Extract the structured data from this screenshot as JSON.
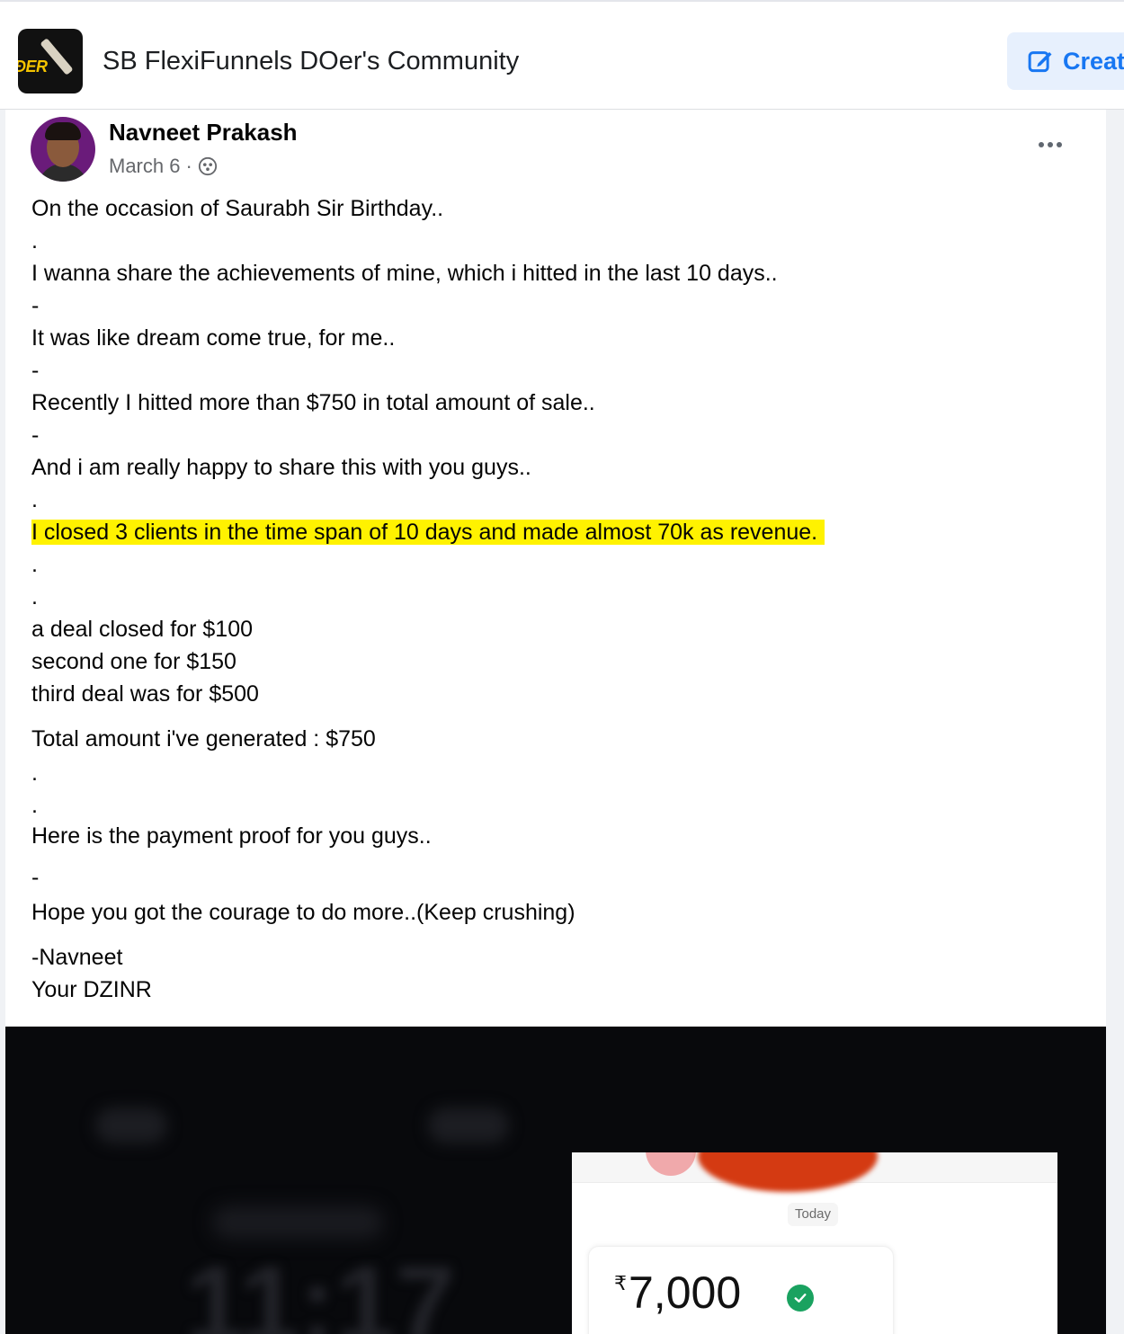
{
  "header": {
    "group_logo_text": "ÐER",
    "group_name": "SB FlexiFunnels DOer's Community",
    "create_label": "Creat"
  },
  "post": {
    "author": "Navneet Prakash",
    "date": "March 6",
    "separator": "·",
    "privacy_icon": "group-members-icon",
    "more_icon": "more-options-icon",
    "lines": [
      "On the occasion of Saurabh Sir Birthday..",
      ".",
      "I wanna share the achievements of mine, which i hitted in the last 10 days..",
      "-",
      "It was like dream come true, for me..",
      "-",
      "Recently I hitted more than $750 in total amount of sale..",
      "-",
      "And i am really happy to share this with you guys..",
      ".",
      "I closed 3 clients in the time span of 10 days and made almost 70k as revenue.",
      ".",
      ".",
      "a deal closed for $100",
      "second one for $150",
      "third deal was for $500",
      "Total amount i've generated : $750",
      ".",
      ".",
      "Here is the payment proof for you guys..",
      "-",
      "Hope you got the courage to do more..(Keep crushing)",
      "-Navneet",
      "Your DZINR"
    ],
    "highlight_color": "#fff200"
  },
  "media": {
    "blurred_time": "11:17",
    "proof": {
      "date_chip": "Today",
      "currency": "₹",
      "amount": "7,000",
      "verified_icon": "check-circle-icon"
    }
  },
  "colors": {
    "accent": "#1877f2",
    "create_bg": "#e7f0fd",
    "muted_text": "#65676b"
  }
}
